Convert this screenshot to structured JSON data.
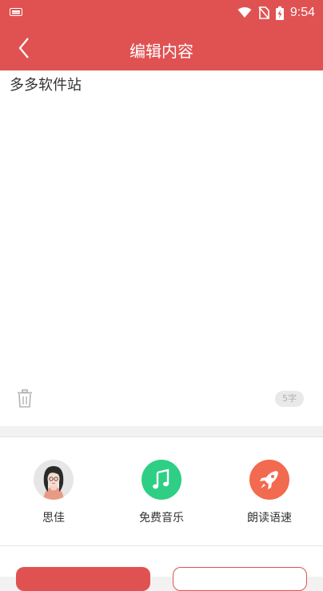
{
  "status_bar": {
    "time": "9:54"
  },
  "header": {
    "title": "编辑内容",
    "back_icon": "chevron-left-icon"
  },
  "editor": {
    "text": "多多软件站",
    "char_count": "5字",
    "delete_icon": "trash-icon"
  },
  "tools": [
    {
      "label": "思佳",
      "icon": "avatar"
    },
    {
      "label": "免费音乐",
      "icon": "music-note-icon"
    },
    {
      "label": "朗读语速",
      "icon": "rocket-icon"
    }
  ],
  "colors": {
    "brand": "#e05252",
    "music": "#2ecf84",
    "speed": "#f26a4f"
  }
}
